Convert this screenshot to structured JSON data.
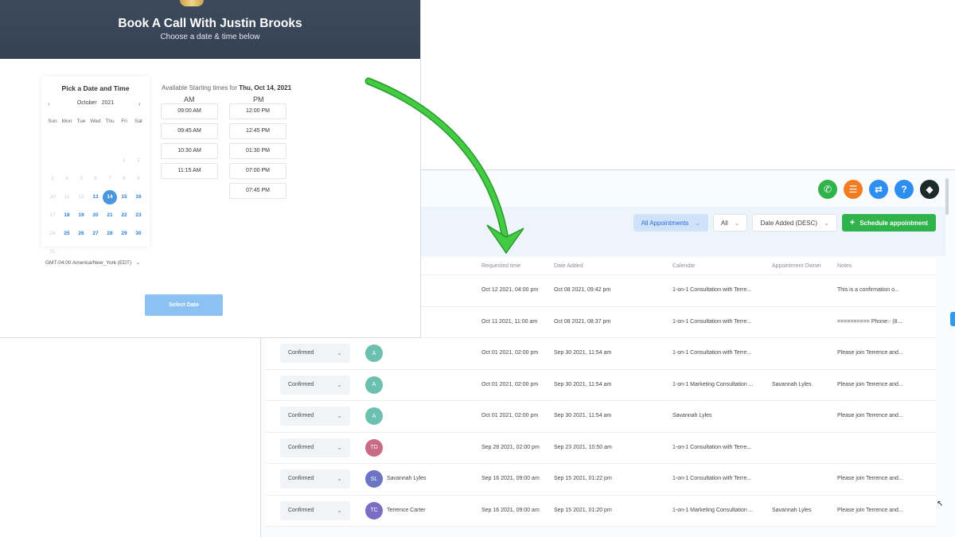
{
  "booking": {
    "title": "Book A Call With Justin Brooks",
    "subtitle": "Choose a date & time below",
    "calendar": {
      "heading": "Pick a Date and Time",
      "month": "October",
      "year": "2021",
      "weekdays": [
        "Sun",
        "Mon",
        "Tue",
        "Wed",
        "Thu",
        "Fri",
        "Sat"
      ],
      "weeks": [
        [
          "",
          "",
          "",
          "",
          "",
          "1",
          "2"
        ],
        [
          "3",
          "4",
          "5",
          "6",
          "7",
          "8",
          "9"
        ],
        [
          "10",
          "11",
          "12",
          "13",
          "14",
          "15",
          "16"
        ],
        [
          "17",
          "18",
          "19",
          "20",
          "21",
          "22",
          "23"
        ],
        [
          "24",
          "25",
          "26",
          "27",
          "28",
          "29",
          "30"
        ],
        [
          "31",
          "",
          "",
          "",
          "",
          "",
          ""
        ]
      ],
      "available_days": [
        "13",
        "14",
        "15",
        "16",
        "18",
        "19",
        "20",
        "21",
        "22",
        "23",
        "25",
        "26",
        "27",
        "28",
        "29",
        "30"
      ],
      "selected_day": "14"
    },
    "available_prefix": "Available Starting times for",
    "available_date": "Thu, Oct 14, 2021",
    "am_label": "AM",
    "pm_label": "PM",
    "am_slots": [
      "09:00 AM",
      "09:45 AM",
      "10:30 AM",
      "11:15 AM"
    ],
    "pm_slots": [
      "12:00 PM",
      "12:45 PM",
      "01:30 PM",
      "07:00 PM",
      "07:45 PM"
    ],
    "timezone": "GMT-04:00 America/New_York (EDT)",
    "select_button": "Select Date"
  },
  "appointments": {
    "filters": {
      "type": "All Appointments",
      "status": "All",
      "sort": "Date Added (DESC)",
      "schedule_button": "Schedule appointment"
    },
    "columns": [
      "Requested time",
      "Date Added",
      "Calendar",
      "Appointment Owner",
      "Notes"
    ],
    "rows": [
      {
        "status": "",
        "avatar": "",
        "avatar_color": "",
        "name": "",
        "requested": "Oct 12 2021, 04:00 pm",
        "added": "Oct 08 2021, 09:42 pm",
        "calendar": "1-on-1 Consultation with Terre...",
        "owner": "",
        "notes": "This is a confirmation o..."
      },
      {
        "status": "",
        "avatar": "",
        "avatar_color": "",
        "name": "",
        "requested": "Oct 11 2021, 11:00 am",
        "added": "Oct 08 2021, 08:37 pm",
        "calendar": "1-on-1 Consultation with Terre...",
        "owner": "",
        "notes": "========== Phone:- (8..."
      },
      {
        "status": "Confirmed",
        "avatar": "A",
        "avatar_color": "#6cc0b0",
        "name": "",
        "requested": "Oct 01 2021, 02:00 pm",
        "added": "Sep 30 2021, 11:54 am",
        "calendar": "1-on-1 Consultation with Terre...",
        "owner": "",
        "notes": "Please join Terrence and..."
      },
      {
        "status": "Confirmed",
        "avatar": "A",
        "avatar_color": "#6cc0b0",
        "name": "",
        "requested": "Oct 01 2021, 02:00 pm",
        "added": "Sep 30 2021, 11:54 am",
        "calendar": "1-on-1 Marketing Consultation ...",
        "owner": "Savannah Lyles",
        "notes": "Please join Terrence and..."
      },
      {
        "status": "Confirmed",
        "avatar": "A",
        "avatar_color": "#6cc0b0",
        "name": "",
        "requested": "Oct 01 2021, 02:00 pm",
        "added": "Sep 30 2021, 11:54 am",
        "calendar": "Savannah Lyles",
        "owner": "",
        "notes": "Please join Terrence and..."
      },
      {
        "status": "Confirmed",
        "avatar": "TD",
        "avatar_color": "#c96a86",
        "name": "",
        "requested": "Sep 28 2021, 02:00 pm",
        "added": "Sep 23 2021, 10:50 am",
        "calendar": "1-on-1 Consultation with Terre...",
        "owner": "",
        "notes": ""
      },
      {
        "status": "Confirmed",
        "avatar": "SL",
        "avatar_color": "#6c74c4",
        "name": "Savannah Lyles",
        "requested": "Sep 16 2021, 09:00 am",
        "added": "Sep 15 2021, 01:22 pm",
        "calendar": "1-on-1 Consultation with Terre...",
        "owner": "",
        "notes": "Please join Terrence and..."
      },
      {
        "status": "Confirmed",
        "avatar": "TC",
        "avatar_color": "#7b6cc4",
        "name": "Terrence Carter",
        "requested": "Sep 16 2021, 09:00 am",
        "added": "Sep 15 2021, 01:20 pm",
        "calendar": "1-on-1 Marketing Consultation ...",
        "owner": "Savannah Lyles",
        "notes": "Please join Terrence and..."
      }
    ]
  },
  "header_icons": [
    {
      "name": "phone-icon",
      "glyph": "✆",
      "color": "#2fb34a"
    },
    {
      "name": "list-icon",
      "glyph": "☰",
      "color": "#f47b20"
    },
    {
      "name": "swap-icon",
      "glyph": "⇄",
      "color": "#2d8ef0"
    },
    {
      "name": "help-icon",
      "glyph": "?",
      "color": "#2d8ef0"
    },
    {
      "name": "brand-logo-icon",
      "glyph": "◆",
      "color": "#1e2a2a"
    }
  ],
  "colors": {
    "hero_bg": "#3d4a5c",
    "accent_blue": "#4a97e0",
    "arrow_green": "#3cc23c",
    "schedule_green": "#2fb34a"
  }
}
